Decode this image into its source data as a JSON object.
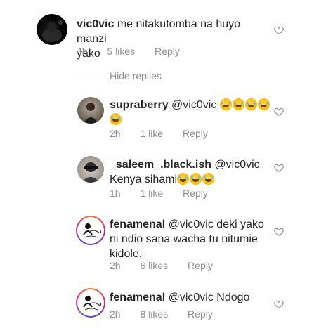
{
  "comments": [
    {
      "username": "vic0vic",
      "text": " me nitakutomba na huyo manzi",
      "text2": "yako",
      "time": "4h",
      "likes": "5 likes",
      "reply": "Reply"
    },
    {
      "username": "supraberry",
      "text": " @vic0vic",
      "time": "2h",
      "likes": "1 like",
      "reply": "Reply"
    },
    {
      "username": "_saleem_.black.ish",
      "text": " @vic0vic",
      "text2": "Kenya sihami",
      "time": "1h",
      "likes": "1 like",
      "reply": "Reply"
    },
    {
      "username": "fenamenal",
      "text": " @vic0vic deki yako",
      "text2": "ni ndio sana wacha tu nitumie",
      "text3": "kidole.",
      "time": "2h",
      "likes": "6 likes",
      "reply": "Reply"
    },
    {
      "username": "fenamenal",
      "text": " @vic0vic Ndogo",
      "time": "2h",
      "likes": "8 likes",
      "reply": "Reply"
    }
  ],
  "hide_replies": "Hide replies",
  "icons": {
    "like": "heart-outline-icon",
    "emoji": "face-with-tears-of-joy-emoji"
  },
  "colors": {
    "text": "#262626",
    "meta": "#8e8e8e",
    "heart": "#8e8e8e"
  }
}
